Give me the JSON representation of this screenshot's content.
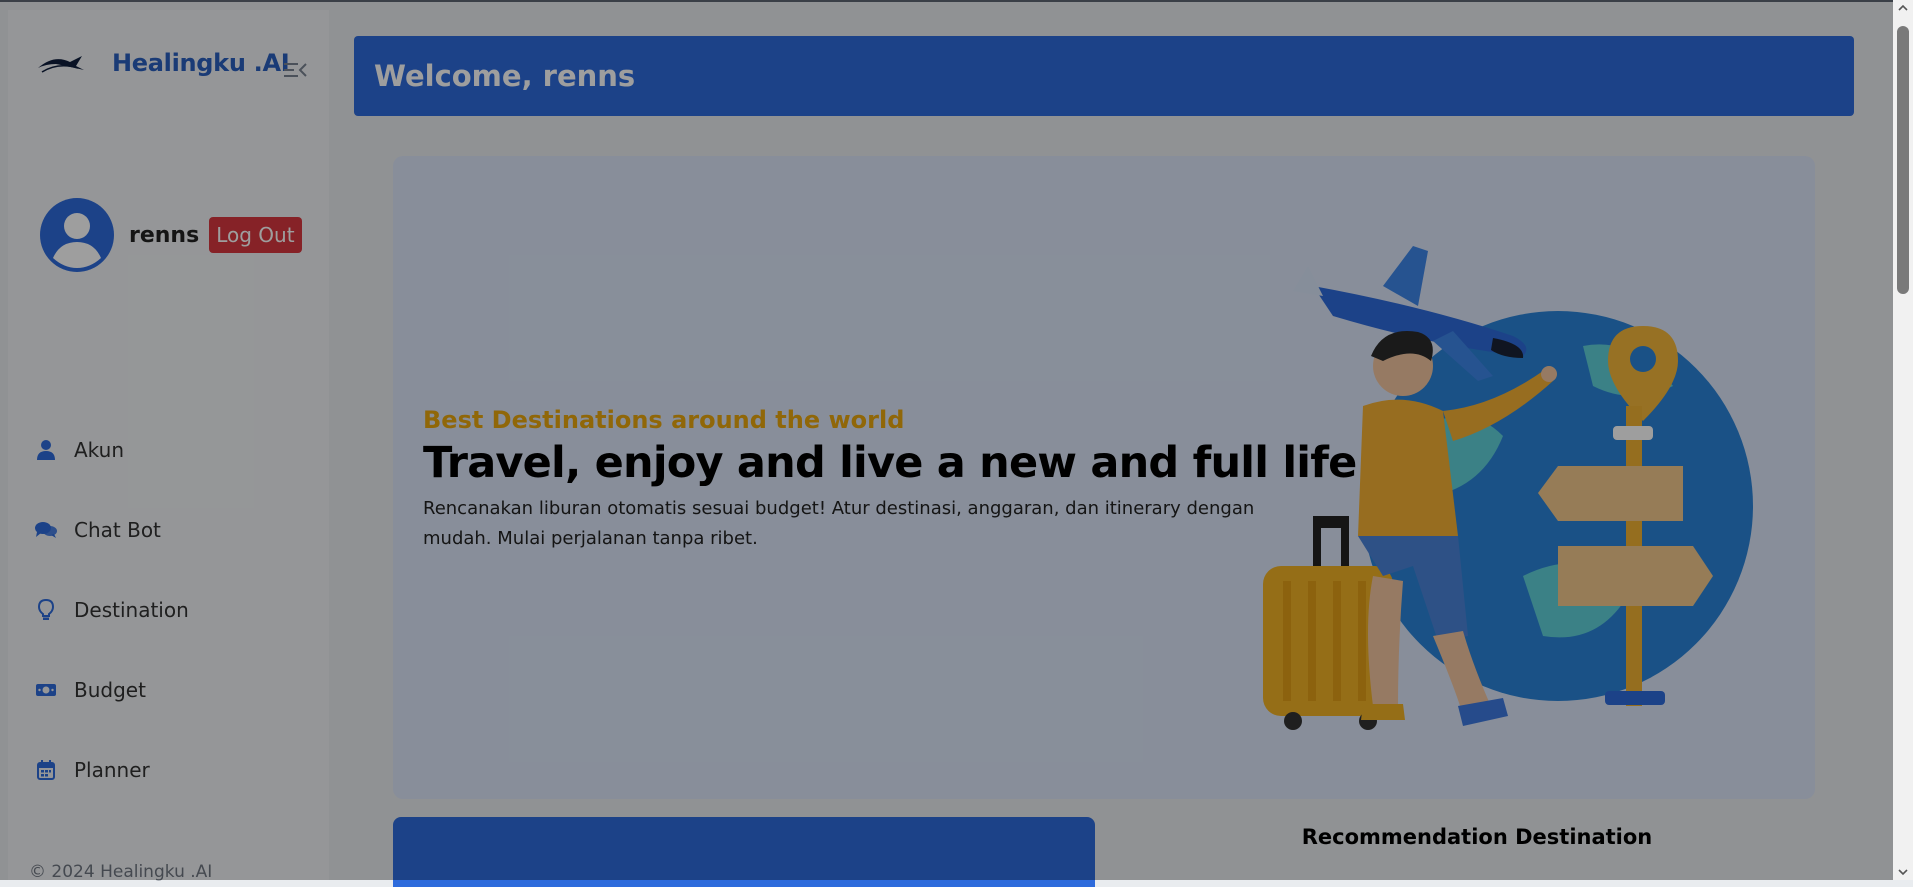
{
  "sidebar": {
    "brand": "Healingku .AI",
    "user": {
      "name": "renns",
      "logout_label": "Log Out"
    },
    "nav": [
      {
        "label": "Akun",
        "icon": "user-icon"
      },
      {
        "label": "Chat Bot",
        "icon": "comments-icon"
      },
      {
        "label": "Destination",
        "icon": "lightbulb-icon"
      },
      {
        "label": "Budget",
        "icon": "money-icon"
      },
      {
        "label": "Planner",
        "icon": "calendar-icon"
      }
    ],
    "footer": "© 2024 Healingku .AI"
  },
  "main": {
    "welcome": "Welcome, renns",
    "hero": {
      "subtitle": "Best Destinations around the world",
      "title": "Travel, enjoy and live a new and full life",
      "description": "Rencanakan liburan otomatis sesuai budget! Atur destinasi, anggaran, dan itinerary dengan mudah. Mulai perjalanan tanpa ribet."
    },
    "recommendation_title": "Recommendation Destination"
  },
  "colors": {
    "accent": "#2e6bdc",
    "logout": "#d9373f",
    "hero_subtitle": "#e8a60d",
    "hero_bg": "#dce6f8"
  }
}
